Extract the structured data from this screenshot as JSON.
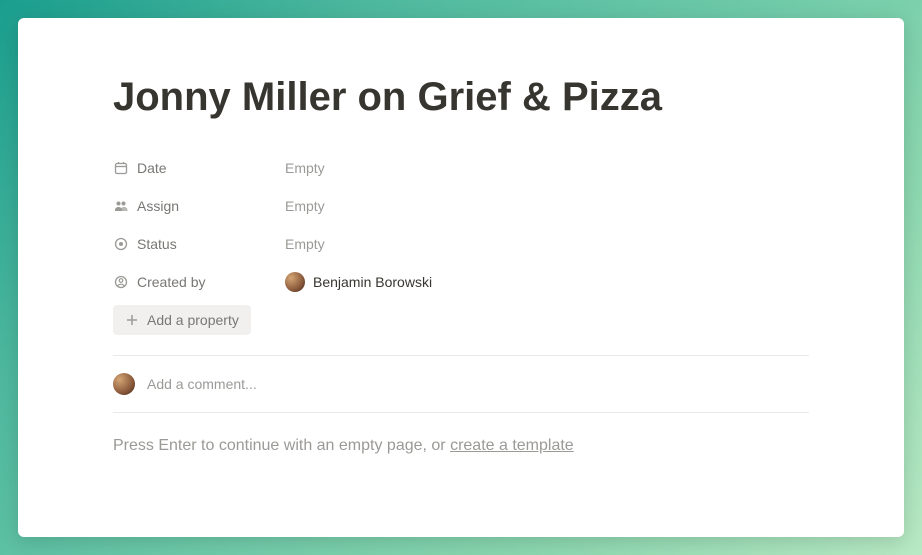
{
  "title": "Jonny Miller on Grief & Pizza",
  "properties": {
    "date": {
      "label": "Date",
      "value": "Empty"
    },
    "assign": {
      "label": "Assign",
      "value": "Empty"
    },
    "status": {
      "label": "Status",
      "value": "Empty"
    },
    "created_by": {
      "label": "Created by",
      "value": "Benjamin Borowski"
    }
  },
  "add_property_label": "Add a property",
  "comment": {
    "placeholder": "Add a comment..."
  },
  "empty_hint": {
    "prefix": "Press Enter to continue with an empty page, or ",
    "link": "create a template"
  }
}
